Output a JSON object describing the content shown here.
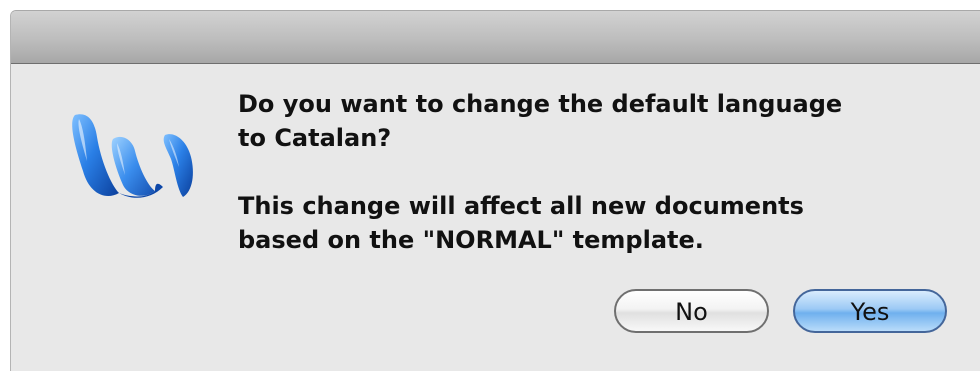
{
  "dialog": {
    "message_line1": "Do you want to change the default language",
    "message_line2": "to Catalan?",
    "detail_line1": "This change will affect all new documents",
    "detail_line2": "based on the \"NORMAL\" template.",
    "icon": "microsoft-word-icon",
    "buttons": {
      "no_label": "No",
      "yes_label": "Yes"
    }
  },
  "colors": {
    "window_background": "#e8e8e8",
    "default_button": "#6fb0ee",
    "icon_blue": "#1a6fd6"
  }
}
